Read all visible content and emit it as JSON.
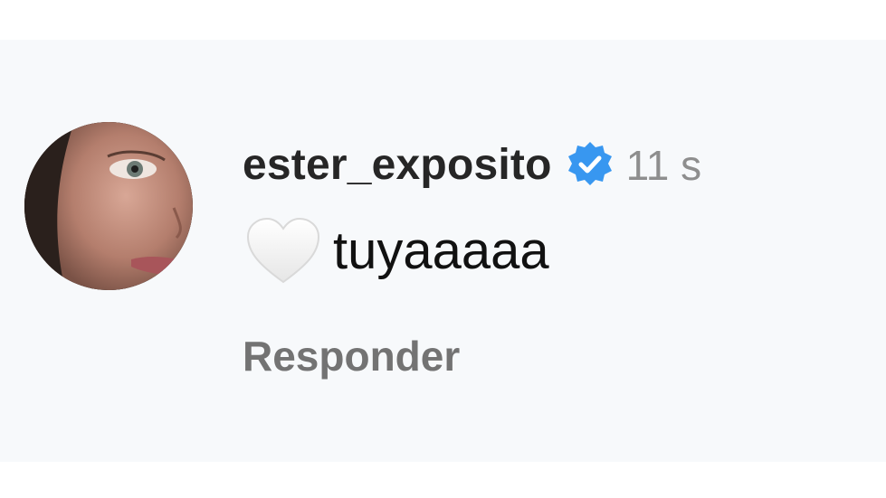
{
  "comment": {
    "username": "ester_exposito",
    "timestamp": "11 s",
    "text": "tuyaaaaa",
    "reply_label": "Responder",
    "verified": true,
    "emoji_icon": "white-heart-icon",
    "verified_icon": "verified-badge-icon"
  },
  "colors": {
    "verified_blue": "#3897f0",
    "username_text": "#262626",
    "timestamp_text": "#8e8e8e",
    "reply_text": "#737373",
    "card_background": "#f7f9fb"
  }
}
